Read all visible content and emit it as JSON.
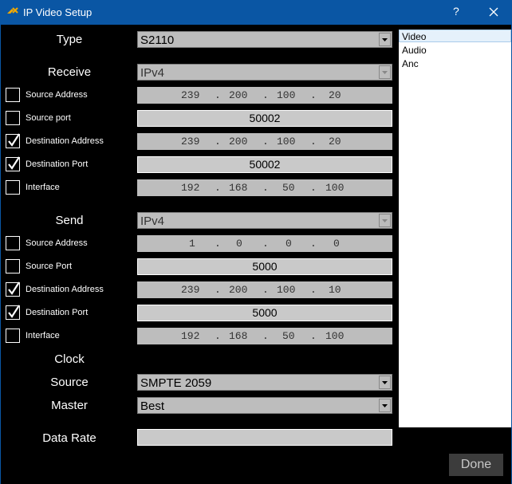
{
  "window": {
    "title": "IP Video Setup",
    "help": "?",
    "close_icon": "close-icon",
    "app_icon": "app-logo-icon"
  },
  "type": {
    "label": "Type",
    "value": "S2110"
  },
  "receive": {
    "label": "Receive",
    "ip_version": "IPv4",
    "source_address": {
      "label": "Source Address",
      "checked": false,
      "octets": [
        "239",
        "200",
        "100",
        "20"
      ]
    },
    "source_port": {
      "label": "Source port",
      "checked": false,
      "value": "50002"
    },
    "destination_address": {
      "label": "Destination Address",
      "checked": true,
      "octets": [
        "239",
        "200",
        "100",
        "20"
      ]
    },
    "destination_port": {
      "label": "Destination Port",
      "checked": true,
      "value": "50002"
    },
    "interface": {
      "label": "Interface",
      "checked": false,
      "octets": [
        "192",
        "168",
        "50",
        "100"
      ]
    }
  },
  "send": {
    "label": "Send",
    "ip_version": "IPv4",
    "source_address": {
      "label": "Source Address",
      "checked": false,
      "octets": [
        "1",
        "0",
        "0",
        "0"
      ]
    },
    "source_port": {
      "label": "Source Port",
      "checked": false,
      "value": "5000"
    },
    "destination_address": {
      "label": "Destination Address",
      "checked": true,
      "octets": [
        "239",
        "200",
        "100",
        "10"
      ]
    },
    "destination_port": {
      "label": "Destination Port",
      "checked": true,
      "value": "5000"
    },
    "interface": {
      "label": "Interface",
      "checked": false,
      "octets": [
        "192",
        "168",
        "50",
        "100"
      ]
    }
  },
  "clock": {
    "label": "Clock",
    "source_label": "Source",
    "source_value": "SMPTE 2059",
    "master_label": "Master",
    "master_value": "Best"
  },
  "data_rate": {
    "label": "Data Rate",
    "value": ""
  },
  "stream_list": {
    "items": [
      "Video",
      "Audio",
      "Anc"
    ],
    "selected": "Video"
  },
  "done_label": "Done",
  "ip_separator": "."
}
